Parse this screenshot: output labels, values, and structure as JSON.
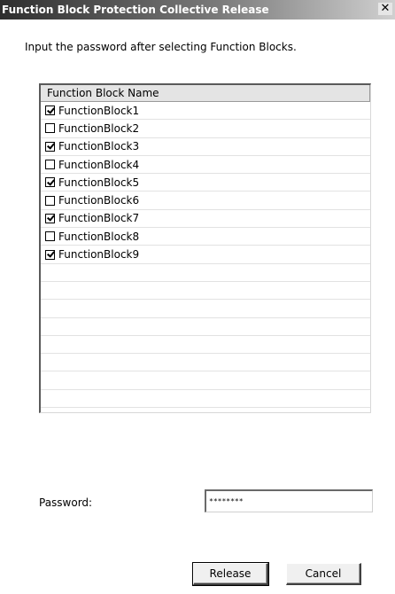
{
  "window": {
    "title": "Function Block Protection Collective Release",
    "close_glyph": "✕"
  },
  "instruction": "Input the password after selecting Function Blocks.",
  "list": {
    "header": "Function Block Name",
    "items": [
      {
        "label": "FunctionBlock1",
        "checked": true
      },
      {
        "label": "FunctionBlock2",
        "checked": false
      },
      {
        "label": "FunctionBlock3",
        "checked": true
      },
      {
        "label": "FunctionBlock4",
        "checked": false
      },
      {
        "label": "FunctionBlock5",
        "checked": true
      },
      {
        "label": "FunctionBlock6",
        "checked": false
      },
      {
        "label": "FunctionBlock7",
        "checked": true
      },
      {
        "label": "FunctionBlock8",
        "checked": false
      },
      {
        "label": "FunctionBlock9",
        "checked": true
      }
    ],
    "empty_rows": 8
  },
  "password": {
    "label": "Password:",
    "value": "********"
  },
  "buttons": {
    "release": "Release",
    "cancel": "Cancel"
  }
}
